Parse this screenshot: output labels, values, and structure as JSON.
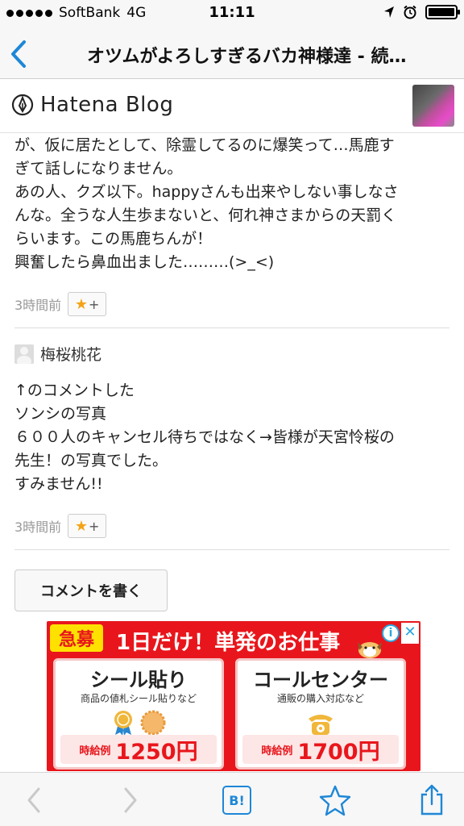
{
  "status_bar": {
    "carrier": "SoftBank",
    "network": "4G",
    "time": "11:11",
    "icons": [
      "location-icon",
      "alarm-icon",
      "battery-icon"
    ]
  },
  "nav": {
    "back_icon": "chevron-left-icon",
    "title": "オツムがよろしすぎるバカ神様達 - 続…"
  },
  "blog_header": {
    "logo_text": "Hatena Blog",
    "logo_icon": "hatena-pen-icon"
  },
  "comments": [
    {
      "lines": [
        "が、仮に居たとして、除霊してるのに爆笑って…馬鹿す",
        "ぎて話しになりません。",
        "あの人、クズ以下。happyさんも出来やしない事しなさ",
        "んな。全うな人生歩まないと、何れ神さまからの天罰く",
        "らいます。この馬鹿ちんが！",
        "興奮したら鼻血出ました………(>_<)"
      ],
      "time": "3時間前",
      "star_label": "+"
    },
    {
      "author": "梅桜桃花",
      "lines": [
        "↑のコメントした",
        "ソンシの写真",
        "６００人のキャンセル待ちではなく→皆様が天宮怜桜の",
        "先生！の写真でした。",
        "すみません!!"
      ],
      "time": "3時間前",
      "star_label": "+"
    }
  ],
  "write_comment_label": "コメントを書く",
  "ad": {
    "badge": "急募",
    "headline": "1日だけ！単発のお仕事",
    "info": "i",
    "close": "✕",
    "cards": [
      {
        "title": "シール貼り",
        "sub": "商品の値札シール貼りなど",
        "pay_label": "時給例",
        "amount": "1250円"
      },
      {
        "title": "コールセンター",
        "sub": "通販の購入対応など",
        "pay_label": "時給例",
        "amount": "1700円"
      }
    ]
  },
  "toolbar": {
    "hatena_b_label": "B!",
    "accent": "#1e87d6"
  }
}
